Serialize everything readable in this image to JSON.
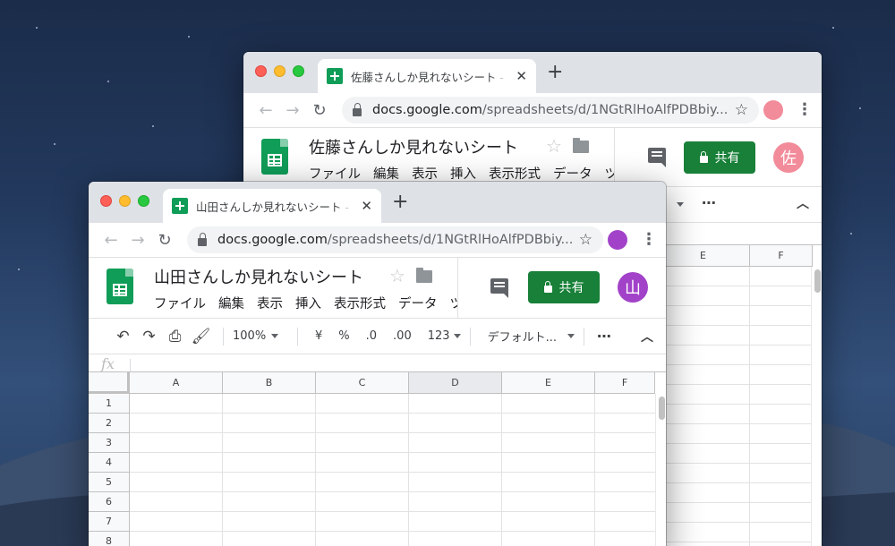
{
  "back_window": {
    "tab_title": "佐藤さんしか見れないシート - Goo",
    "url_domain": "docs.google.com",
    "url_path": "/spreadsheets/d/1NGtRlHoAlfPDBbiy...",
    "doc_title": "佐藤さんしか見れないシート",
    "menu": [
      "ファイル",
      "編集",
      "表示",
      "挿入",
      "表示形式",
      "データ",
      "ツ"
    ],
    "share_label": "共有",
    "avatar_text": "佐",
    "columns": [
      "E",
      "F"
    ]
  },
  "front_window": {
    "tab_title": "山田さんしか見れないシート - Goo",
    "url_domain": "docs.google.com",
    "url_path": "/spreadsheets/d/1NGtRlHoAlfPDBbiy...",
    "doc_title": "山田さんしか見れないシート",
    "menu": [
      "ファイル",
      "編集",
      "表示",
      "挿入",
      "表示形式",
      "データ",
      "ツ"
    ],
    "share_label": "共有",
    "avatar_text": "山",
    "toolbar": {
      "zoom": "100%",
      "currency": "¥",
      "percent": "%",
      "dec_decrease": ".0",
      "dec_increase": ".00",
      "number_format": "123",
      "font": "デフォルト..."
    },
    "fx": "fx",
    "columns": [
      "A",
      "B",
      "C",
      "D",
      "E",
      "F"
    ],
    "selected_column": "D",
    "rows": [
      "1",
      "2",
      "3",
      "4",
      "5",
      "6",
      "7",
      "8"
    ]
  },
  "icons": {
    "more": "⋯",
    "collapse": "︿"
  },
  "colors": {
    "sheets_green": "#0f9d58",
    "share_green": "#188038",
    "avatar_back": "#f28b9a",
    "avatar_front": "#a142c9"
  }
}
